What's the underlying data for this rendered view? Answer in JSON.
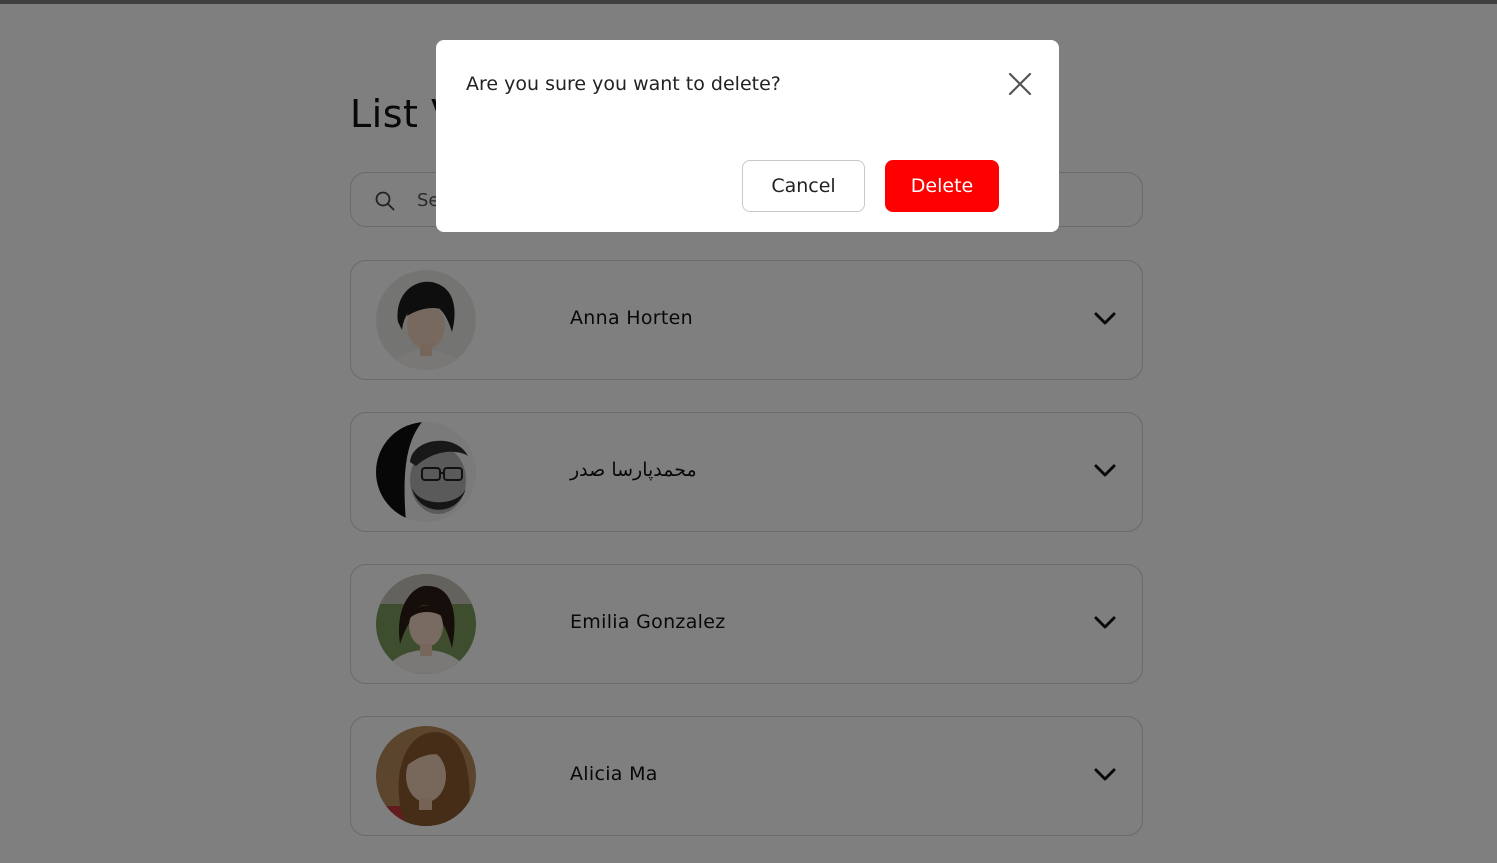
{
  "page": {
    "title": "List View"
  },
  "search": {
    "placeholder": "Search"
  },
  "contacts": [
    {
      "name": "Anna Horten"
    },
    {
      "name": "محمدپارسا صدر"
    },
    {
      "name": "Emilia Gonzalez"
    },
    {
      "name": "Alicia Ma"
    }
  ],
  "modal": {
    "message": "Are you sure you want to delete?",
    "cancel_label": "Cancel",
    "delete_label": "Delete"
  },
  "icons": {
    "search": "search-icon",
    "expand": "chevron-down-icon",
    "close": "close-icon"
  },
  "colors": {
    "danger": "#ff0000",
    "overlay": "rgba(0,0,0,0.5)"
  }
}
